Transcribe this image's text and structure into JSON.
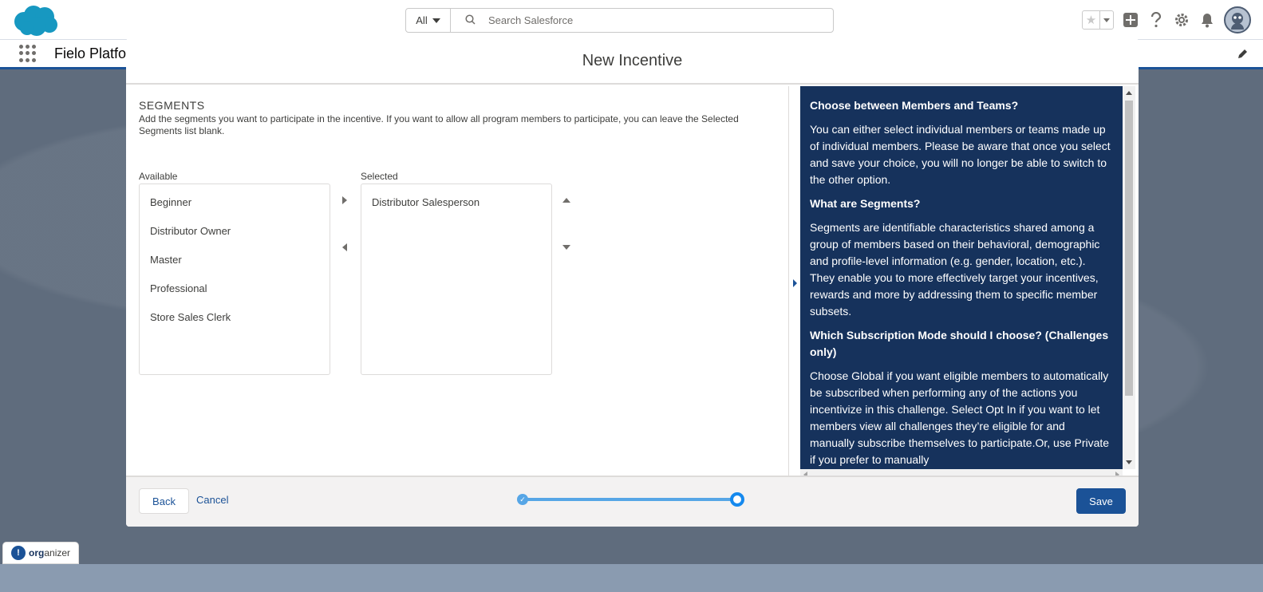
{
  "header": {
    "search_scope": "All",
    "search_placeholder": "Search Salesforce"
  },
  "nav": {
    "app_name": "Fielo Platfo"
  },
  "modal": {
    "title": "New Incentive",
    "segments": {
      "title": "SEGMENTS",
      "help": "Add the segments you want to participate in the incentive. If you want to allow all program members to participate, you can leave the Selected Segments list blank.",
      "available_label": "Available",
      "selected_label": "Selected",
      "available": [
        "Beginner",
        "Distributor Owner",
        "Master",
        "Professional",
        "Store Sales Clerk"
      ],
      "selected": [
        "Distributor Salesperson"
      ]
    },
    "help_panel": [
      {
        "q": "Choose between Members and Teams?",
        "a": "You can either select individual members or teams made up of individual members. Please be aware that once you select and save your choice, you will no longer be able to switch to the other option."
      },
      {
        "q": "What are Segments?",
        "a": "Segments are identifiable characteristics shared among a group of members based on their behavioral, demographic and profile-level information (e.g. gender, location, etc.). They enable you to more effectively target your incentives, rewards and more by addressing them to specific member subsets."
      },
      {
        "q": "Which Subscription Mode should I choose? (Challenges only)",
        "a": "Choose Global if you want eligible members to automatically be subscribed when performing any of the actions you incentivize in this challenge. Select Opt In if you want to let members view all challenges they’re eligible for and manually subscribe themselves to participate.Or, use Private if you prefer to manually"
      }
    ],
    "footer": {
      "back_label": "Back",
      "cancel_label": "Cancel",
      "save_label": "Save",
      "progress_fraction": 1.0
    }
  },
  "organizer": {
    "org": "org",
    "anizer": "anizer"
  },
  "colors": {
    "brand": "#1b5297",
    "help_bg": "#16325c",
    "progress": "#56a6e6"
  }
}
